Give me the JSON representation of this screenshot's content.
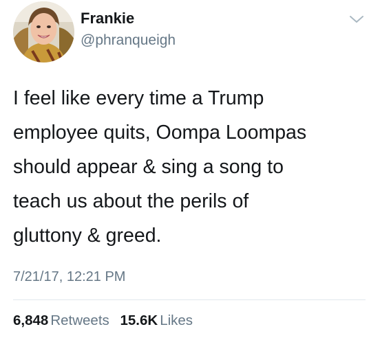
{
  "tweet": {
    "display_name": "Frankie",
    "handle": "@phranqueigh",
    "menu_icon": "chevron-down-icon",
    "text": "I feel like every time a Trump\nemployee quits, Oompa Loompas\nshould appear & sing a song to\nteach us about the perils of\ngluttony & greed.",
    "timestamp": "7/21/17, 12:21 PM",
    "retweets": {
      "count": "6,848",
      "label": "Retweets"
    },
    "likes": {
      "count": "15.6K",
      "label": "Likes"
    }
  },
  "colors": {
    "text_primary": "#14171a",
    "text_secondary": "#657786",
    "divider": "#e1e8ed",
    "background": "#ffffff"
  }
}
